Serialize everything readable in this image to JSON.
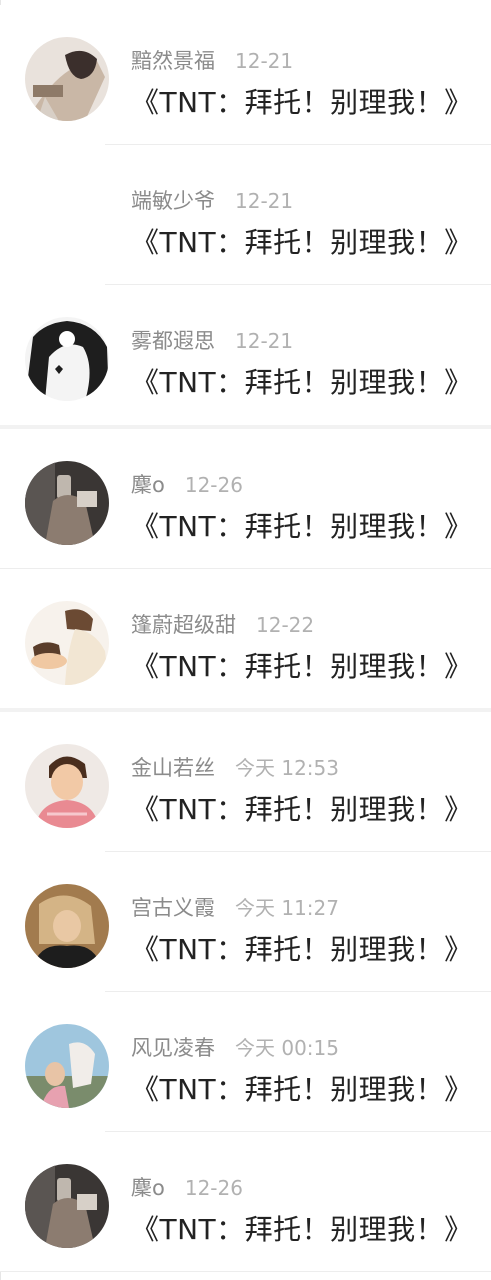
{
  "title_text": "《TNT：拜托！别理我！》",
  "items": [
    {
      "name": "黯然景福",
      "time": "12-21",
      "avatar": "anime-avatar"
    },
    {
      "name": "端敏少爷",
      "time": "12-21",
      "avatar": "none"
    },
    {
      "name": "雾都遐思",
      "time": "12-21",
      "avatar": "sketch-avatar"
    },
    {
      "name": "麇o",
      "time": "12-26",
      "avatar": "mirror-selfie-avatar"
    },
    {
      "name": "篷蔚超级甜",
      "time": "12-22",
      "avatar": "illustration-avatar"
    },
    {
      "name": "金山若丝",
      "time": "今天 12:53",
      "avatar": "boy-photo-avatar"
    },
    {
      "name": "宫古义霞",
      "time": "今天 11:27",
      "avatar": "girl-photo-avatar"
    },
    {
      "name": "风见凌春",
      "time": "今天 00:15",
      "avatar": "horse-photo-avatar"
    },
    {
      "name": "麇o",
      "time": "12-26",
      "avatar": "mirror-selfie-avatar"
    }
  ]
}
